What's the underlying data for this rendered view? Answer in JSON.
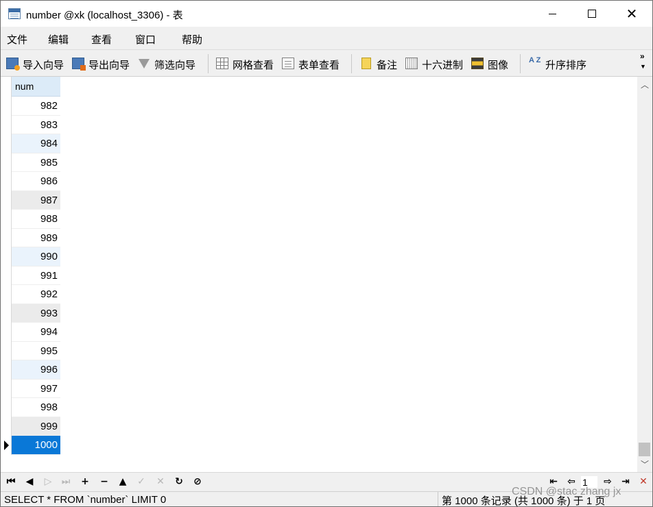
{
  "window": {
    "title": "number @xk (localhost_3306) - 表",
    "controls": {
      "minimize": "",
      "maximize": "",
      "close": "✕"
    }
  },
  "menu": [
    "文件",
    "编辑",
    "查看",
    "窗口",
    "帮助"
  ],
  "toolbar": {
    "import_wizard": "导入向导",
    "export_wizard": "导出向导",
    "filter_wizard": "筛选向导",
    "grid_view": "网格查看",
    "form_view": "表单查看",
    "memo": "备注",
    "hex": "十六进制",
    "image": "图像",
    "sort_asc": "升序排序",
    "sort_icon_text": "A Z",
    "more": "»"
  },
  "grid": {
    "column": "num",
    "rows": [
      "982",
      "983",
      "984",
      "985",
      "986",
      "987",
      "988",
      "989",
      "990",
      "991",
      "992",
      "993",
      "994",
      "995",
      "996",
      "997",
      "998",
      "999",
      "1000"
    ],
    "selected_row": "1000"
  },
  "navbar": {
    "page": "1"
  },
  "status": {
    "sql": "SELECT * FROM `number` LIMIT 0",
    "records": "第 1000 条记录 (共 1000 条) 于 1 页"
  },
  "watermark": "CSDN @stac zhang jx",
  "colors": {
    "selected": "#0a78d7",
    "header": "#dcebf8",
    "alt_blue": "#eaf3fc",
    "alt_gray": "#ebebeb"
  }
}
